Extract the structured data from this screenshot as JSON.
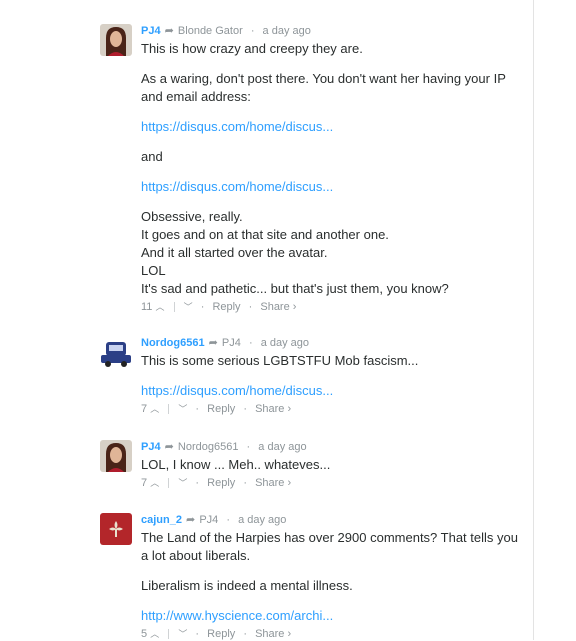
{
  "comments": [
    {
      "author": "PJ4",
      "parent": "Blonde Gator",
      "time": "a day ago",
      "paragraphs": [
        "This is how crazy and creepy they are.",
        "As a waring, don't post there. You don't want her having your IP and email address:",
        "https://disqus.com/home/discus...",
        "and",
        "https://disqus.com/home/discus...",
        "Obsessive, really.",
        "It goes and on at that site and another one.",
        "And it all started over the avatar.",
        "LOL",
        "It's sad and pathetic... but that's just them, you know?"
      ],
      "votes": "11"
    },
    {
      "author": "Nordog6561",
      "parent": "PJ4",
      "time": "a day ago",
      "paragraphs": [
        "This is some serious LGBTSTFU Mob fascism...",
        "https://disqus.com/home/discus..."
      ],
      "votes": "7"
    },
    {
      "author": "PJ4",
      "parent": "Nordog6561",
      "time": "a day ago",
      "paragraphs": [
        "LOL, I know ... Meh.. whateves..."
      ],
      "votes": "7"
    },
    {
      "author": "cajun_2",
      "parent": "PJ4",
      "time": "a day ago",
      "paragraphs": [
        "The Land of the Harpies has over 2900 comments? That tells you a lot about liberals.",
        "Liberalism is indeed a mental illness.",
        "http://www.hyscience.com/archi..."
      ],
      "votes": "5"
    }
  ],
  "actions": {
    "reply": "Reply",
    "share": "Share ›",
    "bullet": "·",
    "upvote": "^",
    "downvote": "v"
  },
  "colors": {
    "author": "#2e9fff",
    "link": "#2e9fff",
    "meta": "#8e9599",
    "text": "#2a2e2e"
  },
  "icons": {
    "reply_arrow": "reply-arrow-icon",
    "upvote": "upvote-icon",
    "downvote": "downvote-icon"
  }
}
